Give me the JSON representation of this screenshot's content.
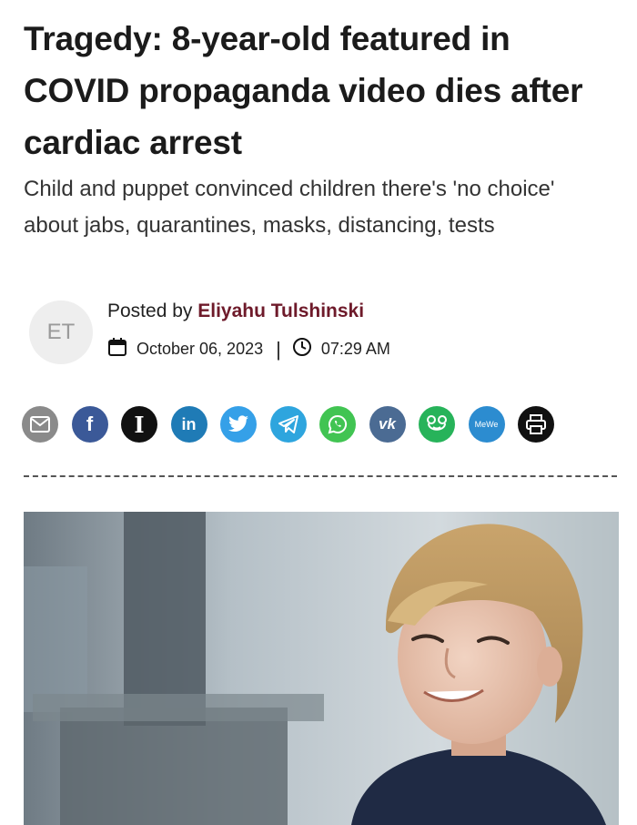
{
  "article": {
    "headline": "Tragedy: 8-year-old featured in COVID propaganda video dies after cardiac arrest",
    "subheadline": "Child and puppet convinced children there's 'no choice' about jabs, quarantines, masks, distancing, tests"
  },
  "byline": {
    "avatar_initials": "ET",
    "posted_by_prefix": "Posted by",
    "author": "Eliyahu Tulshinski",
    "date": "October 06, 2023",
    "separator": "|",
    "time": "07:29 AM",
    "date_icon": "calendar-icon",
    "time_icon": "clock-icon"
  },
  "share": {
    "buttons": [
      {
        "name": "email-share",
        "icon": "envelope-icon",
        "color": "#8a8a8a"
      },
      {
        "name": "facebook-share",
        "icon": "facebook-icon",
        "label": "f",
        "color": "#3b5998"
      },
      {
        "name": "instapaper-share",
        "icon": "instapaper-icon",
        "label": "I",
        "color": "#111111"
      },
      {
        "name": "linkedin-share",
        "icon": "linkedin-icon",
        "label": "in",
        "color": "#1f7bb6"
      },
      {
        "name": "twitter-share",
        "icon": "twitter-icon",
        "color": "#35a0e8"
      },
      {
        "name": "telegram-share",
        "icon": "telegram-icon",
        "color": "#2ea5de"
      },
      {
        "name": "whatsapp-share",
        "icon": "whatsapp-icon",
        "color": "#41c452"
      },
      {
        "name": "vk-share",
        "icon": "vk-icon",
        "label": "vk",
        "color": "#4b6b93"
      },
      {
        "name": "gab-share",
        "icon": "frog-icon",
        "color": "#27b35a"
      },
      {
        "name": "mewe-share",
        "icon": "mewe-icon",
        "label": "MeWe",
        "color": "#2c8cd0"
      },
      {
        "name": "print-share",
        "icon": "printer-icon",
        "color": "#111111"
      }
    ]
  },
  "image": {
    "description_icon": "hero-photo-child"
  }
}
